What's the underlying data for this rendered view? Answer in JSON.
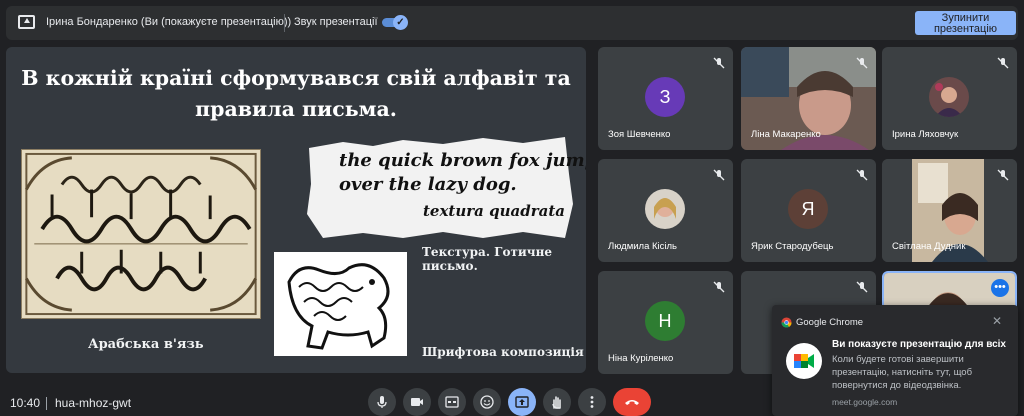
{
  "topbar": {
    "presenter": "Ірина Бондаренко (Ви (покажуєте презентацію))",
    "audio_label": "Звук презентації",
    "stop_button": "Зупинити презентацію"
  },
  "slide": {
    "title_line1": "В кожній країні сформувався свій алфавіт та",
    "title_line2": "правила письма.",
    "gothic_line1": "the quick brown fox jumps",
    "gothic_line2": "over the lazy dog.",
    "gothic_line3": "textura quadrata",
    "caption_arabic": "Арабська в'язь",
    "caption_textura": "Текстура. Готичне письмо.",
    "caption_font": "Шрифтова композиція"
  },
  "participants": [
    {
      "name": "Зоя Шевченко",
      "initial": "З",
      "color": "#673ab7"
    },
    {
      "name": "Ліна Макаренко"
    },
    {
      "name": "Ірина Ляховчук"
    },
    {
      "name": "Людмила Кісіль"
    },
    {
      "name": "Ярик Стародубець",
      "initial": "Я",
      "color": "#5d4037"
    },
    {
      "name": "Світлана Дудник"
    },
    {
      "name": "Ніна Куріленко",
      "initial": "Н",
      "color": "#2e7d32"
    },
    {
      "name": ""
    },
    {
      "name": ""
    }
  ],
  "bottombar": {
    "time": "10:40",
    "meeting_code": "hua-mhoz-gwt"
  },
  "notification": {
    "app": "Google Chrome",
    "close": "✕",
    "title": "Ви показуєте презентацію для всіх",
    "body": "Коли будете готові завершити презентацію, натисніть тут, щоб повернутися до відеодзвінка.",
    "site": "meet.google.com"
  },
  "colors": {
    "accent": "#8ab4f8",
    "end_call": "#ea4335"
  }
}
